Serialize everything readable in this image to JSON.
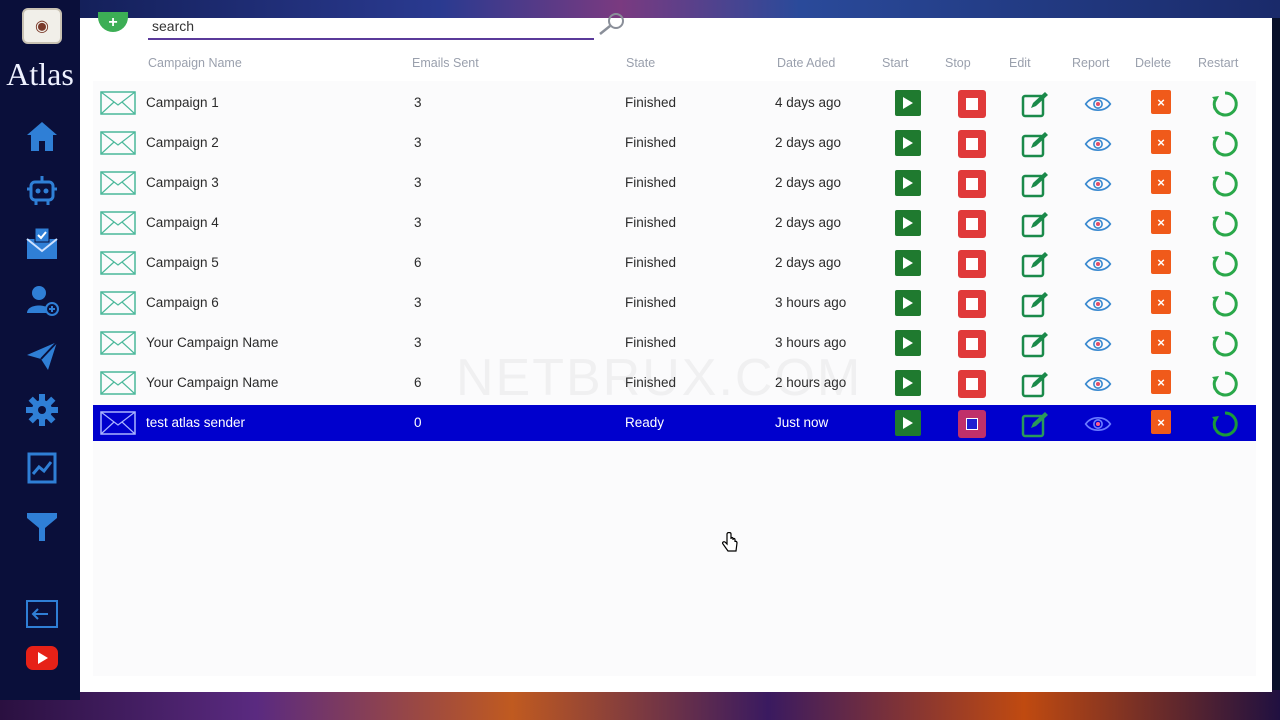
{
  "app": {
    "name": "Atlas"
  },
  "sidebar": {
    "items": [
      {
        "icon": "home-icon"
      },
      {
        "icon": "robot-icon"
      },
      {
        "icon": "mail-check-icon"
      },
      {
        "icon": "add-user-icon"
      },
      {
        "icon": "send-icon"
      },
      {
        "icon": "gear-icon"
      },
      {
        "icon": "analytics-icon"
      },
      {
        "icon": "filter-icon"
      },
      {
        "icon": "logout-icon"
      },
      {
        "icon": "youtube-icon"
      }
    ]
  },
  "search": {
    "placeholder": "search"
  },
  "table": {
    "headers": {
      "campaign_name": "Campaign Name",
      "emails_sent": "Emails Sent",
      "state": "State",
      "date_added": "Date Aded",
      "start": "Start",
      "stop": "Stop",
      "edit": "Edit",
      "report": "Report",
      "delete": "Delete",
      "restart": "Restart"
    },
    "rows": [
      {
        "name": "Campaign 1",
        "sent": "3",
        "state": "Finished",
        "date": "4 days ago"
      },
      {
        "name": "Campaign 2",
        "sent": "3",
        "state": "Finished",
        "date": "2 days ago"
      },
      {
        "name": " Campaign 3",
        "sent": "3",
        "state": "Finished",
        "date": "2 days ago"
      },
      {
        "name": " Campaign 4",
        "sent": "3",
        "state": "Finished",
        "date": "2 days ago"
      },
      {
        "name": "Campaign 5",
        "sent": "6",
        "state": "Finished",
        "date": "2 days ago"
      },
      {
        "name": "Campaign 6",
        "sent": "3",
        "state": "Finished",
        "date": "3 hours ago"
      },
      {
        "name": "Your Campaign Name",
        "sent": "3",
        "state": "Finished",
        "date": "3 hours ago"
      },
      {
        "name": "Your Campaign Name",
        "sent": "6",
        "state": "Finished",
        "date": "2 hours ago"
      },
      {
        "name": "test atlas sender",
        "sent": "0",
        "state": "Ready",
        "date": "Just now",
        "selected": true
      }
    ]
  },
  "watermark": "NETBRUX.COM",
  "colors": {
    "sidebar_bg": "#0a0f3a",
    "selected_row": "#0000cd",
    "start_green": "#1f7a2f",
    "stop_red": "#e03a3a",
    "edit_green": "#1a8a4a",
    "report_blue": "#3a8ad0",
    "delete_orange": "#f05a1a",
    "restart_green": "#2aa84a"
  }
}
